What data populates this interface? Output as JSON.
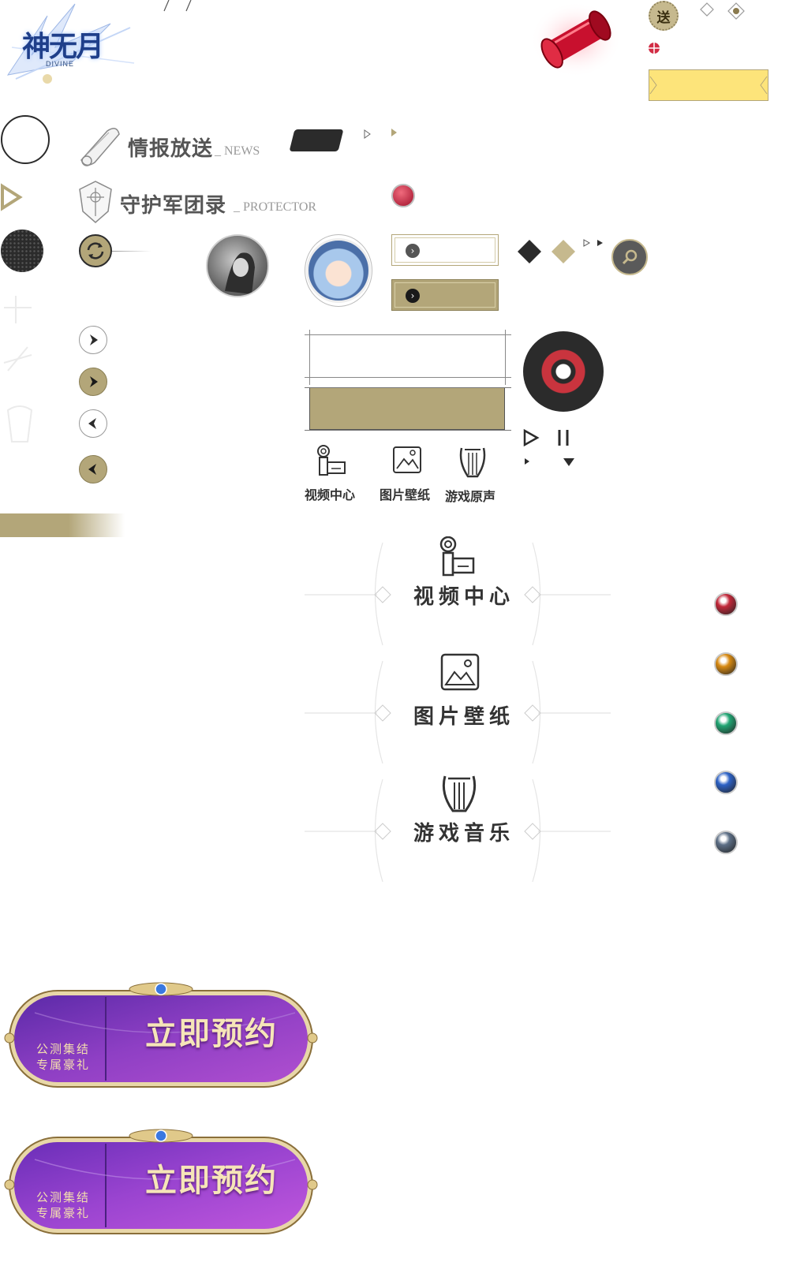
{
  "logo": {
    "title": "神无月",
    "subtitle": "DIVINE"
  },
  "send_badge": "送",
  "sections": {
    "news": {
      "title": "情报放送",
      "subtitle": "_ NEWS"
    },
    "protector": {
      "title": "守护军团录",
      "subtitle": "_ PROTECTOR"
    }
  },
  "small_nav": [
    {
      "label": "视频中心",
      "icon": "video-camera-icon"
    },
    {
      "label": "图片壁纸",
      "icon": "picture-icon"
    },
    {
      "label": "游戏原声",
      "icon": "lyre-icon"
    }
  ],
  "big_nav": [
    {
      "label": "视频中心",
      "icon": "video-camera-icon"
    },
    {
      "label": "图片壁纸",
      "icon": "picture-icon"
    },
    {
      "label": "游戏音乐",
      "icon": "lyre-icon"
    }
  ],
  "element_gems": [
    {
      "name": "fire",
      "color": "#c2283a"
    },
    {
      "name": "light",
      "color": "#d88a12"
    },
    {
      "name": "wind",
      "color": "#21a573"
    },
    {
      "name": "water",
      "color": "#2d62c6"
    },
    {
      "name": "dark",
      "color": "#5d6f86"
    }
  ],
  "cta_buttons": [
    {
      "main": "立即预约",
      "sub_line1": "公测集结",
      "sub_line2": "专属豪礼"
    },
    {
      "main": "立即预约",
      "sub_line1": "公测集结",
      "sub_line2": "专属豪礼"
    }
  ],
  "colors": {
    "accent_gold": "#b3a679",
    "dark": "#2b2b2b",
    "highlight_yellow": "#fde47a",
    "purple": "#7b39b8"
  }
}
